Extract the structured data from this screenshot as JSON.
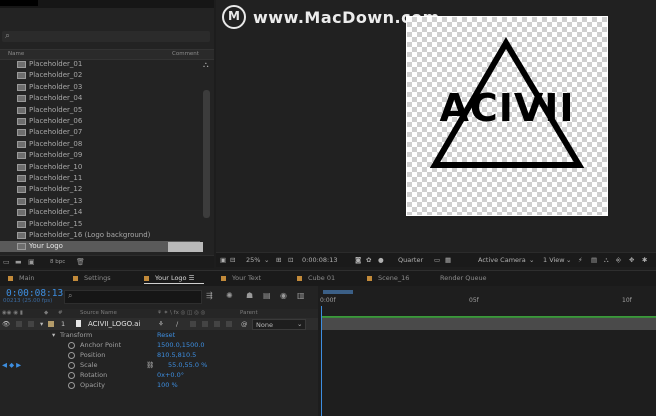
{
  "project": {
    "columns": {
      "name": "Name",
      "comment": "Comment"
    },
    "items": [
      "Placeholder_01",
      "Placeholder_02",
      "Placeholder_03",
      "Placeholder_04",
      "Placeholder_05",
      "Placeholder_06",
      "Placeholder_07",
      "Placeholder_08",
      "Placeholder_09",
      "Placeholder_10",
      "Placeholder_11",
      "Placeholder_12",
      "Placeholder_13",
      "Placeholder_14",
      "Placeholder_15",
      "Placeholder_16 (Logo background)",
      "Your Logo"
    ],
    "footer_bpc": "8 bpc"
  },
  "watermark": {
    "icon_letter": "M",
    "text": "www.MacDown.com"
  },
  "canvas": {
    "logo_text": "ACIVII"
  },
  "viewer_bar": {
    "zoom": "25%",
    "timecode": "0:00:08:13",
    "resolution": "Quarter",
    "camera": "Active Camera",
    "views": "1 View"
  },
  "tabs": [
    "Main",
    "Settings",
    "Your Logo",
    "Your Text",
    "Cube 01",
    "Scene_16",
    "Render Queue"
  ],
  "timeline": {
    "timecode": "0:00:08:13",
    "fps": "00213 (25.00 fps)",
    "col_source": "Source Name",
    "col_parent": "Parent",
    "layer": {
      "index": "1",
      "name": "ACIVII_LOGO.ai",
      "parent": "None"
    },
    "transform": {
      "label": "Transform",
      "reset": "Reset"
    },
    "properties": [
      {
        "name": "Anchor Point",
        "value": "1500.0,1500.0"
      },
      {
        "name": "Position",
        "value": "810.5,810.5"
      },
      {
        "name": "Scale",
        "value": "55.0,55.0 %"
      },
      {
        "name": "Rotation",
        "value": "0x+0.0°"
      },
      {
        "name": "Opacity",
        "value": "100 %"
      }
    ],
    "ruler": [
      "0:00f",
      "05f",
      "10f"
    ]
  },
  "colors": {
    "accent": "#3d8ee0",
    "layer_green": "#3a9a3a"
  }
}
